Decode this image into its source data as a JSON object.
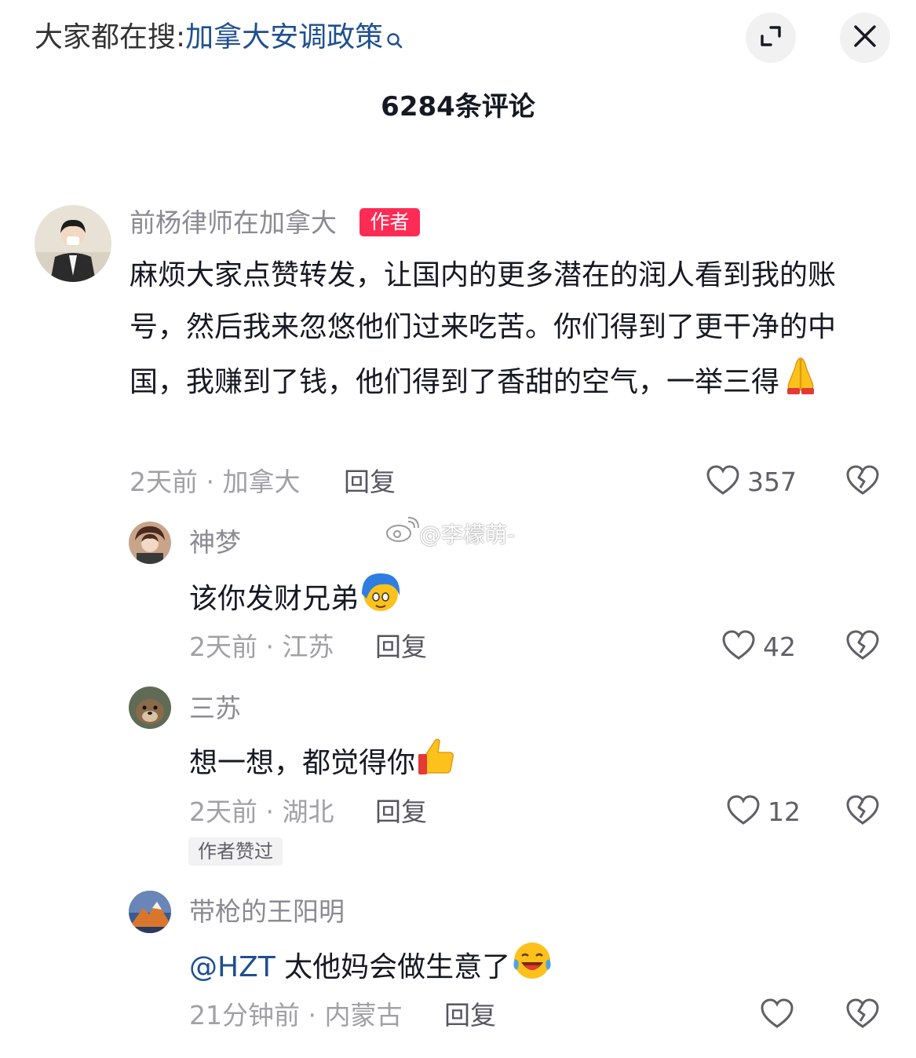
{
  "header": {
    "search_prefix": "大家都在搜:",
    "search_term": "加拿大安调政策",
    "comment_count": "6284条评论"
  },
  "watermark": "@李檬萌-",
  "comments": [
    {
      "username": "前杨律师在加拿大",
      "author_tag": "作者",
      "text": "麻烦大家点赞转发，让国内的更多潜在的润人看到我的账号，然后我来忽悠他们过来吃苦。你们得到了更干净的中国，我赚到了钱，他们得到了香甜的空气，一举三得",
      "emoji": "folded-hands",
      "meta": "2天前 · 加拿大",
      "reply": "回复",
      "likes": "357"
    },
    {
      "username": "神梦",
      "text": "该你发财兄弟",
      "emoji": "cartoon-face",
      "meta": "2天前 · 江苏",
      "reply": "回复",
      "likes": "42"
    },
    {
      "username": "三苏",
      "text": "想一想，都觉得你",
      "emoji": "thumbs-up",
      "meta": "2天前 · 湖北",
      "reply": "回复",
      "likes": "12",
      "author_liked": "作者赞过"
    },
    {
      "username": "带枪的王阳明",
      "mention": "@HZT",
      "text": " 太他妈会做生意了",
      "emoji": "crying-laughing",
      "meta": "21分钟前 · 内蒙古",
      "reply": "回复",
      "likes": ""
    }
  ],
  "colors": {
    "author_tag": "#fe2c55",
    "link_blue": "#1f4f8f",
    "meta_gray": "#a0a0a5"
  }
}
